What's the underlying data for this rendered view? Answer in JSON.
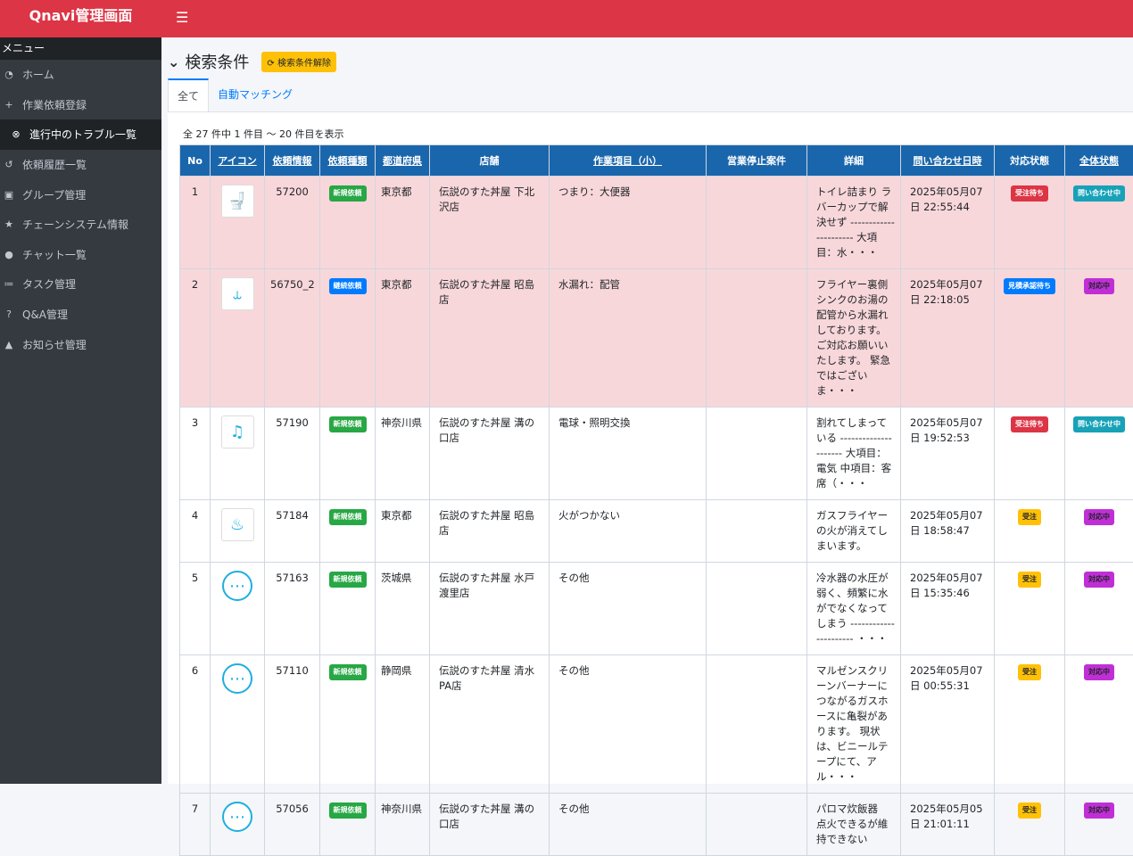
{
  "app_title": "Qnavi管理画面",
  "sidebar": {
    "header": "メニュー",
    "items": [
      {
        "label": "ホーム",
        "icon": "tachometer-icon"
      },
      {
        "label": "作業依頼登録",
        "icon": "plus-icon"
      },
      {
        "label": "進行中のトラブル一覧",
        "icon": "x-circle-icon"
      },
      {
        "label": "依頼履歴一覧",
        "icon": "history-icon"
      },
      {
        "label": "グループ管理",
        "icon": "image-icon"
      },
      {
        "label": "チェーンシステム情報",
        "icon": "star-icon"
      },
      {
        "label": "チャット一覧",
        "icon": "chat-icon"
      },
      {
        "label": "タスク管理",
        "icon": "list-icon"
      },
      {
        "label": "Q&A管理",
        "icon": "question-icon"
      },
      {
        "label": "お知らせ管理",
        "icon": "bell-icon"
      }
    ]
  },
  "search": {
    "title": "検索条件",
    "clear_label": "検索条件解除"
  },
  "tabs": [
    "全て",
    "自動マッチング"
  ],
  "count_text": "全 27 件中 1 件目 ～ 20 件目を表示",
  "columns": [
    "No",
    "アイコン",
    "依頼情報",
    "依頼種類",
    "都道府県",
    "店舗",
    "作業項目（小）",
    "営業停止案件",
    "詳細",
    "問い合わせ日時",
    "対応状態",
    "全体状態"
  ],
  "colors": {
    "header": "#dc3545",
    "sidebar": "#343a40",
    "table_header": "#1a66ac",
    "highlight": "#f8d7da"
  },
  "rows": [
    {
      "no": "1",
      "icon": "toilet-icon",
      "id": "57200",
      "type": "新規依頼",
      "type_color": "#28a745",
      "pref": "東京都",
      "store": "伝説のすた丼屋 下北沢店",
      "work": "つまり：大便器",
      "stop": "",
      "detail": "トイレ詰まり ラバーカップで解決せず ---------------------- 大項目：水・・・",
      "date": "2025年05月07日 22:55:44",
      "status": "受注待ち",
      "status_color": "#dc3545",
      "overall": "問い合わせ中",
      "overall_color": "#17a2b8",
      "hl": true
    },
    {
      "no": "2",
      "icon": "pipe-icon",
      "id": "56750_2",
      "type": "継続依頼",
      "type_color": "#007bff",
      "pref": "東京都",
      "store": "伝説のすた丼屋 昭島店",
      "work": "水漏れ：配管",
      "stop": "",
      "detail": "フライヤー裏側シンクのお湯の配管から水漏れしております。 ご対応お願いいたします。 緊急ではございま・・・",
      "date": "2025年05月07日 22:18:05",
      "status": "見積承認待ち",
      "status_color": "#007bff",
      "overall": "対応中",
      "overall_color": "#c02fd6",
      "hl": true
    },
    {
      "no": "3",
      "icon": "lamp-icon",
      "id": "57190",
      "type": "新規依頼",
      "type_color": "#28a745",
      "pref": "神奈川県",
      "store": "伝説のすた丼屋 溝の口店",
      "work": "電球・照明交換",
      "stop": "",
      "detail": "割れてしまっている --------------------- 大項目：電気 中項目：客席（・・・",
      "date": "2025年05月07日 19:52:53",
      "status": "受注待ち",
      "status_color": "#dc3545",
      "overall": "問い合わせ中",
      "overall_color": "#17a2b8",
      "hl": false
    },
    {
      "no": "4",
      "icon": "stove-icon",
      "id": "57184",
      "type": "新規依頼",
      "type_color": "#28a745",
      "pref": "東京都",
      "store": "伝説のすた丼屋 昭島店",
      "work": "火がつかない",
      "stop": "",
      "detail": "ガスフライヤーの火が消えてしまいます。",
      "date": "2025年05月07日 18:58:47",
      "status": "受注",
      "status_color": "#ffc107",
      "overall": "対応中",
      "overall_color": "#c02fd6",
      "hl": false
    },
    {
      "no": "5",
      "icon": "more-icon",
      "id": "57163",
      "type": "新規依頼",
      "type_color": "#28a745",
      "pref": "茨城県",
      "store": "伝説のすた丼屋 水戸渡里店",
      "work": "その他",
      "stop": "",
      "detail": "冷水器の水圧が弱く、頻繁に水がでなくなってしまう ---------------------- ・・・",
      "date": "2025年05月07日 15:35:46",
      "status": "受注",
      "status_color": "#ffc107",
      "overall": "対応中",
      "overall_color": "#c02fd6",
      "hl": false
    },
    {
      "no": "6",
      "icon": "more-icon",
      "id": "57110",
      "type": "新規依頼",
      "type_color": "#28a745",
      "pref": "静岡県",
      "store": "伝説のすた丼屋 清水PA店",
      "work": "その他",
      "stop": "",
      "detail": "マルゼンスクリーンバーナーにつながるガスホースに亀裂があります。 現状は、ビニールテープにて、アル・・・",
      "date": "2025年05月07日 00:55:31",
      "status": "受注",
      "status_color": "#ffc107",
      "overall": "対応中",
      "overall_color": "#c02fd6",
      "hl": false
    },
    {
      "no": "7",
      "icon": "more-icon",
      "id": "57056",
      "type": "新規依頼",
      "type_color": "#28a745",
      "pref": "神奈川県",
      "store": "伝説のすた丼屋 溝の口店",
      "work": "その他",
      "stop": "",
      "detail": "パロマ炊飯器　点火できるが維持できない",
      "date": "2025年05月05日 21:01:11",
      "status": "受注",
      "status_color": "#ffc107",
      "overall": "対応中",
      "overall_color": "#c02fd6",
      "hl": false
    }
  ]
}
